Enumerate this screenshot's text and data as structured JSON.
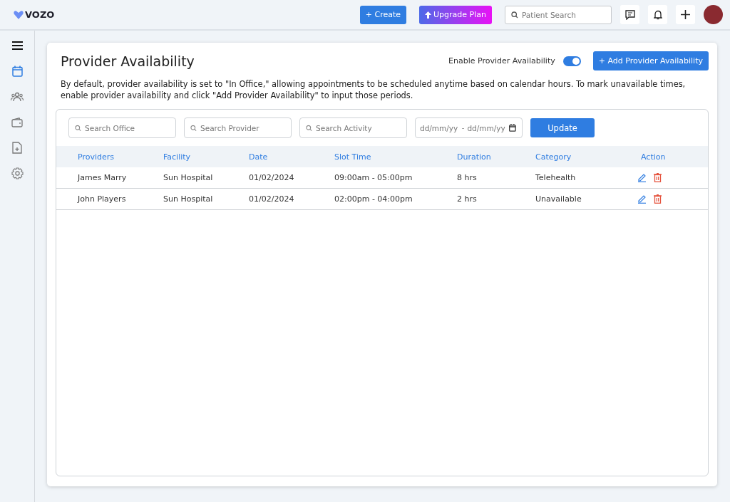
{
  "header": {
    "logo": "VOZO",
    "create_button": "+ Create",
    "upgrade_button": "Upgrade Plan",
    "search": {
      "placeholder": "Patient Search"
    }
  },
  "sidebar": {
    "items": [
      {
        "kind": "menu",
        "selected": false
      },
      {
        "kind": "calendar",
        "selected": true
      },
      {
        "kind": "people",
        "selected": false
      },
      {
        "kind": "wallet",
        "selected": false
      },
      {
        "kind": "file",
        "selected": false
      },
      {
        "kind": "settings",
        "selected": false
      }
    ]
  },
  "page": {
    "title": "Provider Availability",
    "toggle": {
      "label": "Enable Provider Availability",
      "on": true
    },
    "add_button": "+ Add Provider Availability",
    "description": "By default, provider availability is set to \"In Office,\" allowing appointments to be scheduled anytime based on calendar hours. To mark unavailable times, enable provider availability and click \"Add Provider Availability\" to input those periods."
  },
  "filters": {
    "searches": [
      {
        "placeholder": "Search Office"
      },
      {
        "placeholder": "Search Provider"
      },
      {
        "placeholder": "Search Activity"
      }
    ],
    "date_range": {
      "start_placeholder": "dd/mm/yy",
      "separator": "-",
      "end_placeholder": "dd/mm/yy"
    },
    "update_button": "Update"
  },
  "table": {
    "columns": [
      "Providers",
      "Facility",
      "Date",
      "Slot Time",
      "Duration",
      "Category",
      "Action"
    ],
    "rows": [
      {
        "cells": [
          "James Marry",
          "Sun Hospital",
          "01/02/2024",
          "09:00am - 05:00pm",
          "8 hrs",
          "Telehealth"
        ]
      },
      {
        "cells": [
          "John Players",
          "Sun Hospital",
          "01/02/2024",
          "02:00pm - 04:00pm",
          "2 hrs",
          "Unavailable"
        ]
      }
    ]
  }
}
